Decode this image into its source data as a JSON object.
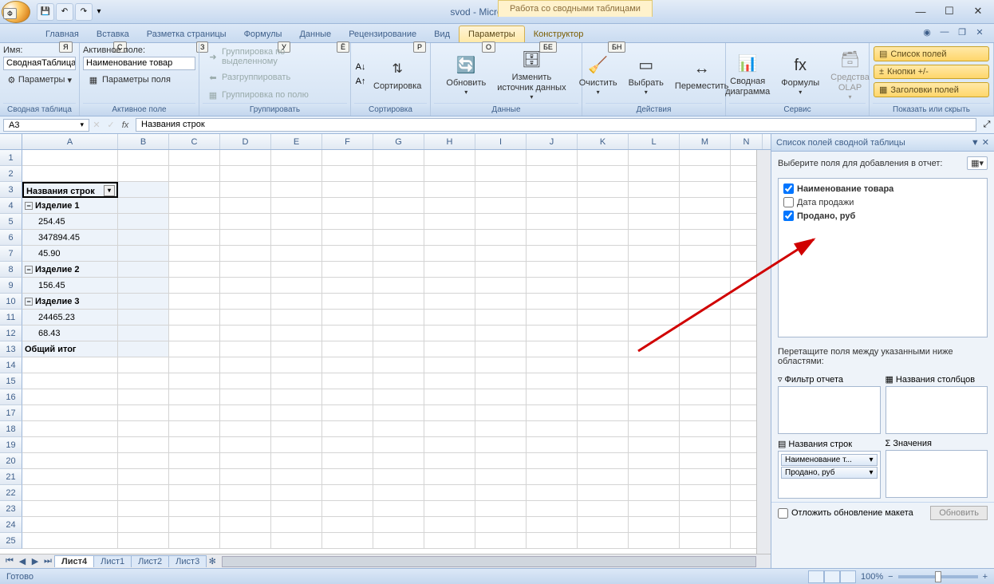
{
  "titlebar": {
    "title": "svod - Microsoft Excel",
    "context_tab": "Работа со сводными таблицами"
  },
  "tabs": {
    "home": "Главная",
    "insert": "Вставка",
    "layout": "Разметка страницы",
    "formulas": "Формулы",
    "data": "Данные",
    "review": "Рецензирование",
    "view": "Вид",
    "options": "Параметры",
    "design": "Конструктор"
  },
  "hints": {
    "home": "Я",
    "insert": "С",
    "layout": "З",
    "formulas": "У",
    "data": "Ё",
    "review": "Р",
    "view": "О",
    "options": "БЕ",
    "design": "БН"
  },
  "ribbon": {
    "name_group": {
      "label": "Сводная таблица",
      "name_label": "Имя:",
      "name_value": "СводнаяТаблица",
      "params": "Параметры"
    },
    "active_field": {
      "label": "Активное поле",
      "title": "Активное поле:",
      "value": "Наименование товар",
      "params": "Параметры поля"
    },
    "grouping": {
      "label": "Группировать",
      "by_sel": "Группировка по выделенному",
      "ungroup": "Разгруппировать",
      "by_field": "Группировка по полю"
    },
    "sort": {
      "label": "Сортировка",
      "btn": "Сортировка"
    },
    "data": {
      "label": "Данные",
      "refresh": "Обновить",
      "change_src": "Изменить\nисточник данных"
    },
    "actions": {
      "label": "Действия",
      "clear": "Очистить",
      "select": "Выбрать",
      "move": "Переместить"
    },
    "tools": {
      "label": "Сервис",
      "chart": "Сводная\nдиаграмма",
      "formulas": "Формулы",
      "olap": "Средства\nOLAP"
    },
    "show": {
      "label": "Показать или скрыть",
      "fields": "Список полей",
      "buttons": "Кнопки +/-",
      "headers": "Заголовки полей"
    }
  },
  "formula_bar": {
    "name_box": "A3",
    "formula": "Названия строк"
  },
  "columns": [
    "A",
    "B",
    "C",
    "D",
    "E",
    "F",
    "G",
    "H",
    "I",
    "J",
    "K",
    "L",
    "M",
    "N"
  ],
  "grid": {
    "r3_a": "Названия строк",
    "r4_a": "Изделие 1",
    "r5_a": "254.45",
    "r6_a": "347894.45",
    "r7_a": "45.90",
    "r8_a": "Изделие 2",
    "r9_a": "156.45",
    "r10_a": "Изделие 3",
    "r11_a": "24465.23",
    "r12_a": "68.43",
    "r13_a": "Общий итог"
  },
  "sheets": {
    "s1": "Лист4",
    "s2": "Лист1",
    "s3": "Лист2",
    "s4": "Лист3"
  },
  "pane": {
    "title": "Список полей сводной таблицы",
    "prompt": "Выберите поля для добавления в отчет:",
    "fields": {
      "f1": "Наименование товара",
      "f2": "Дата продажи",
      "f3": "Продано, руб"
    },
    "drag_prompt": "Перетащите поля между указанными ниже областями:",
    "areas": {
      "filter": "Фильтр отчета",
      "cols": "Названия столбцов",
      "rows": "Названия строк",
      "values": "Значения"
    },
    "row_items": {
      "i1": "Наименование т...",
      "i2": "Продано, руб"
    },
    "defer": "Отложить обновление макета",
    "update": "Обновить"
  },
  "status": {
    "ready": "Готово",
    "zoom": "100%"
  }
}
